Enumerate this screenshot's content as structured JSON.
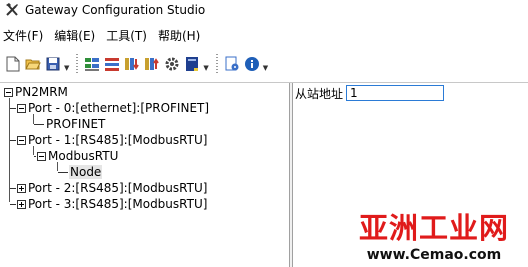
{
  "window": {
    "title": "Gateway Configuration Studio",
    "icon": "tools-icon"
  },
  "menu": [
    {
      "label": "文件(F)"
    },
    {
      "label": "编辑(E)"
    },
    {
      "label": "工具(T)"
    },
    {
      "label": "帮助(H)"
    }
  ],
  "toolbar": {
    "buttons": [
      "new-icon",
      "open-folder-icon",
      "save-icon",
      "add-module-icon",
      "delete-module-icon",
      "download-icon",
      "upload-icon",
      "settings-gear-icon",
      "book-icon",
      "doc-stamp-icon",
      "info-icon"
    ]
  },
  "tree": {
    "root": "PN2MRM",
    "port0": "Port - 0:[ethernet]:[PROFINET]",
    "port0_child": "PROFINET",
    "port1": "Port - 1:[RS485]:[ModbusRTU]",
    "port1_child": "ModbusRTU",
    "port1_grandchild": "Node",
    "port2": "Port - 2:[RS485]:[ModbusRTU]",
    "port3": "Port - 3:[RS485]:[ModbusRTU]"
  },
  "detail": {
    "slave_address_label": "从站地址",
    "slave_address_value": "1"
  },
  "watermark": {
    "main": "亚洲工业网",
    "url": "www.Cemao.com"
  },
  "colors": {
    "accent": "#2b7bd6",
    "watermark_red": "#e01b1b"
  }
}
